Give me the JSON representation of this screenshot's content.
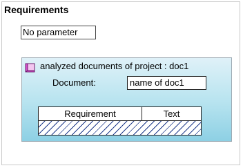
{
  "section": {
    "title": "Requirements",
    "parameter": "No parameter"
  },
  "panel": {
    "title": "analyzed documents of project : doc1",
    "document_label": "Document:",
    "document_value": "name of doc1",
    "icon": "book-icon"
  },
  "table": {
    "columns": [
      "Requirement",
      "Text"
    ]
  },
  "colors": {
    "panel_gradient_top": "#dff1f8",
    "panel_gradient_bottom": "#8dd0e4",
    "hatch": "#1e3a8a"
  }
}
